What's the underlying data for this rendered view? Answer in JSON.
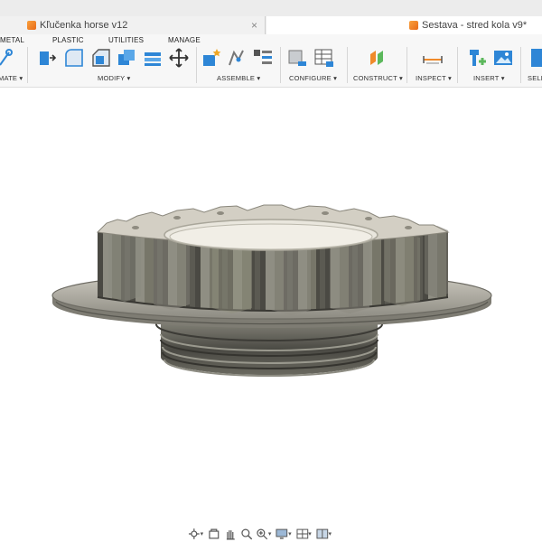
{
  "tabs": [
    {
      "label": "Kľučenka horse v12",
      "active": false,
      "close": "×"
    },
    {
      "label": "Sestava - stred kola v9*",
      "active": true
    }
  ],
  "toolbar": {
    "tabs": [
      "METAL",
      "PLASTIC",
      "UTILITIES",
      "MANAGE"
    ],
    "groups": {
      "create_partial": "MATE ▾",
      "modify": "MODIFY ▾",
      "assemble": "ASSEMBLE ▾",
      "configure": "CONFIGURE ▾",
      "construct": "CONSTRUCT ▾",
      "inspect": "INSPECT ▾",
      "insert": "INSERT ▾",
      "select_partial": "SELE"
    }
  },
  "navbar": {
    "dropdown_marker": "▾",
    "tools": [
      "orbit-icon",
      "look-at-icon",
      "pan-icon",
      "zoom-icon",
      "zoom-window-icon",
      "display-settings-icon",
      "grid-settings-icon",
      "viewports-icon"
    ]
  },
  "colors": {
    "accent_orange": "#f08a2a",
    "tool_blue": "#2e86d6",
    "model_metal": "#6b6a60"
  }
}
